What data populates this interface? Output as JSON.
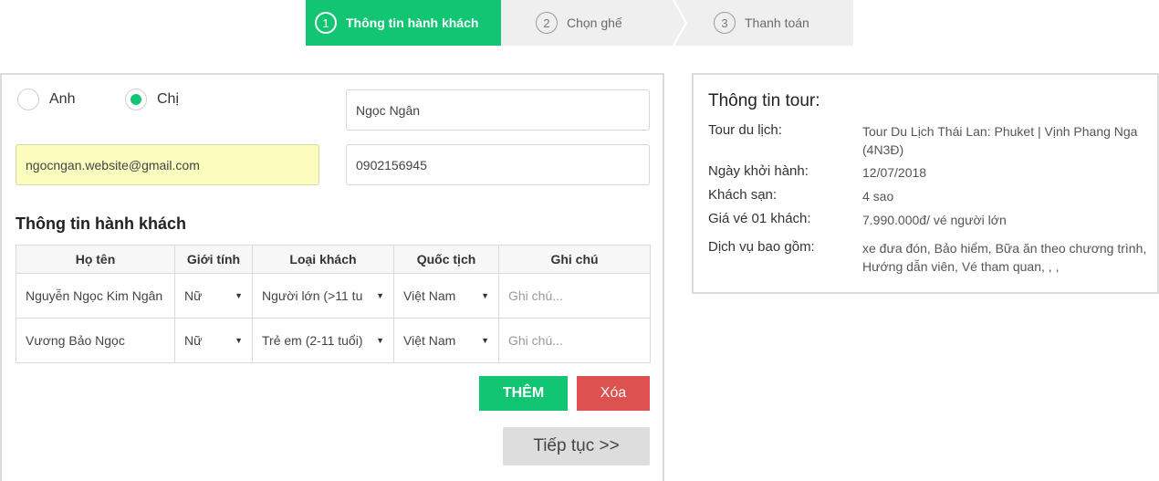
{
  "stepper": {
    "steps": [
      {
        "num": "1",
        "label": "Thông tin hành khách",
        "active": true
      },
      {
        "num": "2",
        "label": "Chọn ghế",
        "active": false
      },
      {
        "num": "3",
        "label": "Thanh toán",
        "active": false
      }
    ]
  },
  "form": {
    "salutation": {
      "options": [
        {
          "label": "Anh",
          "checked": false
        },
        {
          "label": "Chị",
          "checked": true
        }
      ]
    },
    "name_value": "Ngọc Ngân",
    "email_value": "ngocngan.website@gmail.com",
    "phone_value": "0902156945"
  },
  "passengers": {
    "title": "Thông tin hành khách",
    "columns": [
      "Họ tên",
      "Giới tính",
      "Loại khách",
      "Quốc tịch",
      "Ghi chú"
    ],
    "rows": [
      {
        "name": "Nguyễn Ngọc Kim Ngân",
        "gender": "Nữ",
        "type": "Người lớn (>11 tu",
        "nationality": "Việt Nam",
        "note_placeholder": "Ghi chú..."
      },
      {
        "name": "Vương Bảo Ngọc",
        "gender": "Nữ",
        "type": "Trẻ em (2-11 tuổi)",
        "nationality": "Việt Nam",
        "note_placeholder": "Ghi chú..."
      }
    ],
    "add_label": "THÊM",
    "delete_label": "Xóa",
    "next_label": "Tiếp tục >>"
  },
  "tour": {
    "title": "Thông tin tour:",
    "rows": [
      {
        "label": "Tour du lịch:",
        "value": "Tour Du Lịch Thái Lan: Phuket | Vịnh Phang Nga (4N3Đ)"
      },
      {
        "label": "Ngày khởi hành:",
        "value": "12/07/2018"
      },
      {
        "label": "Khách sạn:",
        "value": "4 sao"
      },
      {
        "label": "Giá vé 01 khách:",
        "value": "7.990.000đ/ vé người lớn"
      },
      {
        "label": "Dịch vụ bao gồm:",
        "value": "xe đưa đón, Bảo hiểm, Bữa ăn theo chương trình, Hướng dẫn viên, Vé tham quan, , ,"
      }
    ]
  },
  "colors": {
    "accent": "#11c573",
    "danger": "#dd5150",
    "email_highlight": "#fbfdbf"
  },
  "icons": {
    "select_caret": "caret-down-icon",
    "step_separator": "chevron-right-icon"
  }
}
